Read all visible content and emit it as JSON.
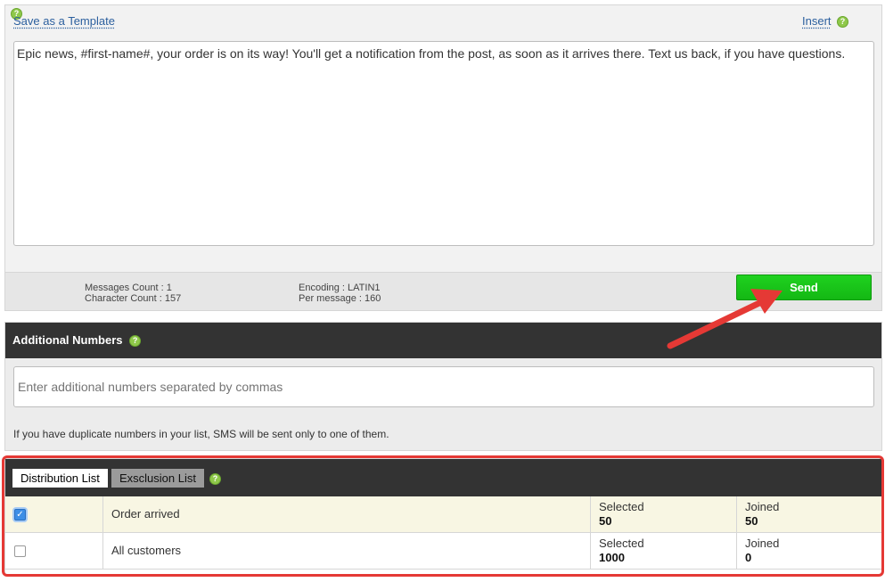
{
  "compose": {
    "save_template_label": "Save as a Template",
    "insert_label": "Insert",
    "message_text": "Epic news, #first-name#, your order is on its way! You'll get a notification from the post, as soon as it arrives there. Text us back, if you have questions.",
    "stats": {
      "messages_count": "Messages Count : 1",
      "character_count": "Character Count : 157",
      "encoding": "Encoding : LATIN1",
      "per_message": "Per message : 160"
    },
    "send_label": "Send"
  },
  "additional_numbers": {
    "title": "Additional Numbers",
    "placeholder": "Enter additional numbers separated by commas",
    "note": "If you have duplicate numbers in your list, SMS will be sent only to one of them."
  },
  "lists": {
    "tabs": [
      {
        "label": "Distribution List"
      },
      {
        "label": "Exsclusion List"
      }
    ],
    "rows": [
      {
        "checked": true,
        "name": "Order arrived",
        "selected_label": "Selected",
        "selected_value": "50",
        "joined_label": "Joined",
        "joined_value": "50"
      },
      {
        "checked": false,
        "name": "All customers",
        "selected_label": "Selected",
        "selected_value": "1000",
        "joined_label": "Joined",
        "joined_value": "0"
      }
    ]
  },
  "icons": {
    "help": "help-icon",
    "check": "check-icon"
  },
  "colors": {
    "send_green": "#14b814",
    "header_dark": "#333333",
    "annotation_red": "#e53935",
    "link_blue": "#2b5f9e"
  }
}
